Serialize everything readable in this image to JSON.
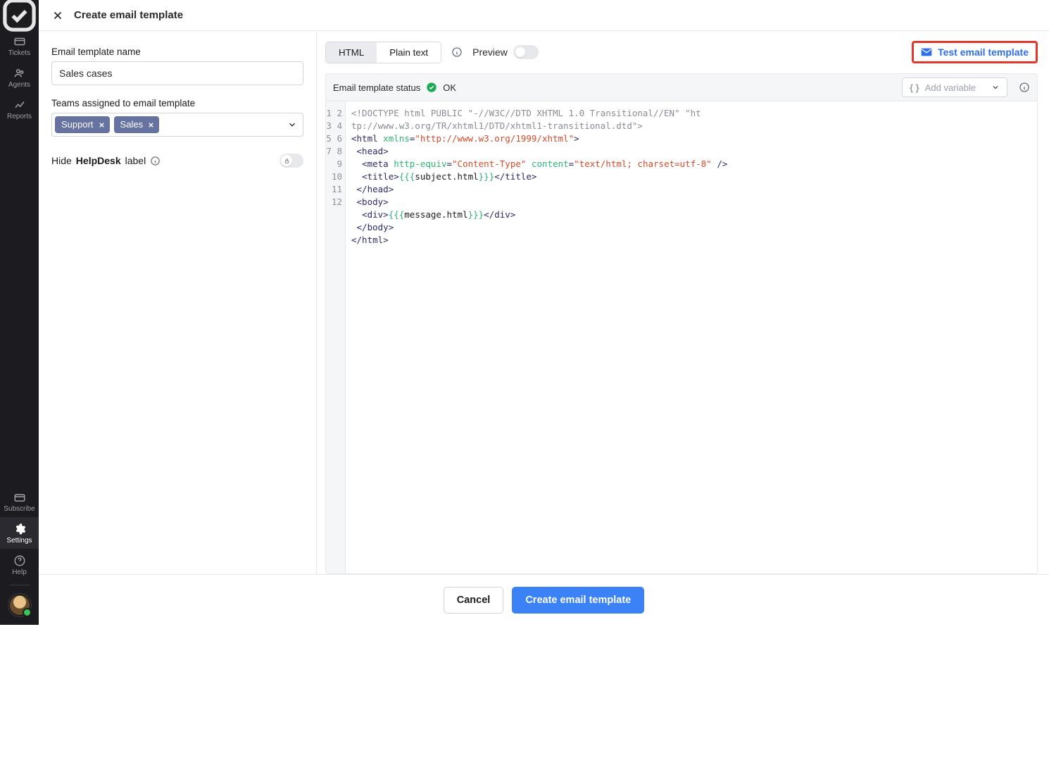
{
  "rail": {
    "items": [
      {
        "label": "Tickets"
      },
      {
        "label": "Agents"
      },
      {
        "label": "Reports"
      }
    ],
    "bottom": [
      {
        "label": "Subscribe"
      },
      {
        "label": "Settings"
      },
      {
        "label": "Help"
      }
    ]
  },
  "header": {
    "title": "Create email template"
  },
  "form": {
    "name_label": "Email template name",
    "name_value": "Sales cases",
    "teams_label": "Teams assigned to email template",
    "teams": [
      "Support",
      "Sales"
    ],
    "hide_label_pre": "Hide ",
    "hide_label_bold": "HelpDesk",
    "hide_label_post": " label"
  },
  "editor": {
    "tab_html": "HTML",
    "tab_plain": "Plain text",
    "preview": "Preview",
    "test_btn": "Test email template",
    "status_label": "Email template status",
    "status_value": "OK",
    "addvar_placeholder": "Add variable",
    "line_count": 12,
    "code": {
      "doctype": "<!DOCTYPE html PUBLIC \"-//W3C//DTD XHTML 1.0 Transitional//EN\" \"http://www.w3.org/TR/xhtml1/DTD/xhtml1-transitional.dtd\">",
      "xmlns": "http://www.w3.org/1999/xhtml",
      "content_type_attr": "Content-Type",
      "content_type_val": "text/html; charset=utf-8",
      "subject_var": "subject.html",
      "message_var": "message.html"
    }
  },
  "footer": {
    "cancel": "Cancel",
    "create": "Create email template"
  }
}
